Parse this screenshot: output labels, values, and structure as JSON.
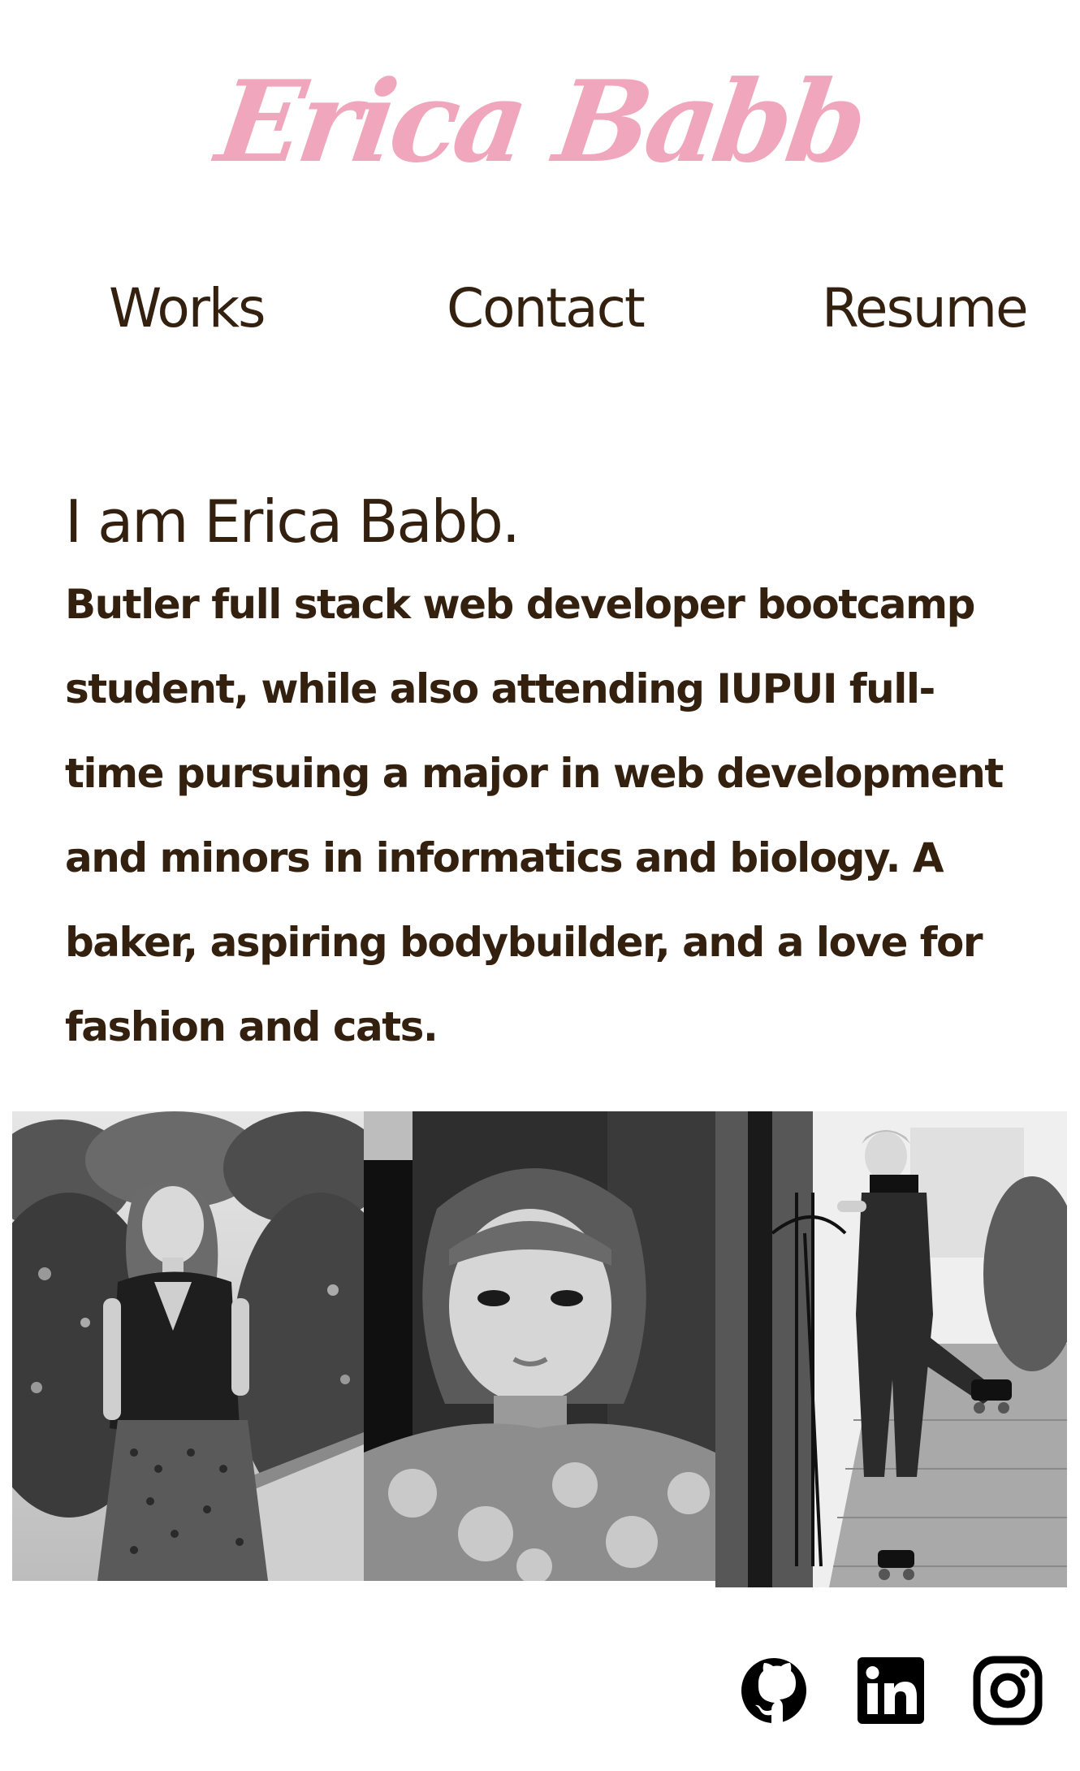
{
  "header": {
    "logo_text": "Erica Babb"
  },
  "nav": {
    "items": [
      {
        "label": "Works"
      },
      {
        "label": "Contact"
      },
      {
        "label": "Resume"
      }
    ]
  },
  "intro": {
    "heading": "I am Erica Babb.",
    "bio": "Butler full stack web developer bootcamp student, while also attending IUPUI full-time pursuing a major in web development and minors in informatics and biology. A baker, aspiring bodybuilder, and a love for fashion and cats."
  },
  "gallery": {
    "photos": [
      {
        "alt": "Erica standing outdoors among shrubs in a dark top and patterned skirt"
      },
      {
        "alt": "Close-up portrait of Erica in a floral mesh top"
      },
      {
        "alt": "Erica in overalls and roller skates leaning on an iron gate"
      }
    ],
    "style": "black-and-white"
  },
  "socials": {
    "items": [
      {
        "icon": "github-icon"
      },
      {
        "icon": "linkedin-icon"
      },
      {
        "icon": "instagram-icon"
      }
    ]
  },
  "colors": {
    "logo": "#f0a7bd",
    "text": "#33200f",
    "background": "#ffffff",
    "icons": "#000000"
  }
}
